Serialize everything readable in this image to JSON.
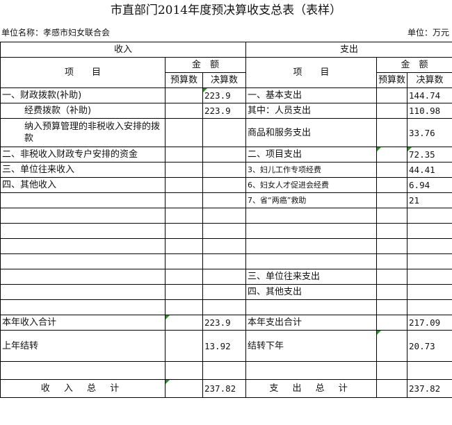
{
  "title": "市直部门2014年度预决算收支总表（表样）",
  "unit_name": "单位名称：孝感市妇女联合会",
  "unit": "单位：万元",
  "headers": {
    "income": "收入",
    "expense": "支出",
    "item": "项　　目",
    "amount": "金　额",
    "budget": "预算数",
    "final": "决算数"
  },
  "income_rows": [
    {
      "label": "一、财政拨款(补助)",
      "budget": "",
      "final": "223.9"
    },
    {
      "label": "经费拨款（补助)",
      "budget": "",
      "final": "223.9"
    },
    {
      "label": "纳入预算管理的非税收入安排的拨款",
      "budget": "",
      "final": ""
    },
    {
      "label": "二、非税收入财政专户安排的资金",
      "budget": "",
      "final": ""
    },
    {
      "label": "三、单位往来收入",
      "budget": "",
      "final": ""
    },
    {
      "label": "四、其他收入",
      "budget": "",
      "final": ""
    }
  ],
  "expense_rows": [
    {
      "label": "一、基本支出",
      "budget": "",
      "final": "144.74"
    },
    {
      "label": "其中：人员支出",
      "budget": "",
      "final": "110.98"
    },
    {
      "label": "商品和服务支出",
      "budget": "",
      "final": "33.76"
    },
    {
      "label": "二、项目支出",
      "budget": "",
      "final": "72.35"
    },
    {
      "label": "3、妇儿工作专项经费",
      "budget": "",
      "final": "44.41"
    },
    {
      "label": "6、妇女人才促进会经费",
      "budget": "",
      "final": "6.94"
    },
    {
      "label": "7、省“两癌”救助",
      "budget": "",
      "final": "21"
    },
    {
      "label": "三、单位往来支出",
      "budget": "",
      "final": ""
    },
    {
      "label": "四、其他支出",
      "budget": "",
      "final": ""
    }
  ],
  "totals": {
    "income_year_label": "本年收入合计",
    "income_year_final": "223.9",
    "expense_year_label": "本年支出合计",
    "expense_year_final": "217.09",
    "carry_in_label": "上年结转",
    "carry_in_final": "13.92",
    "carry_out_label": "结转下年",
    "carry_out_final": "20.73",
    "income_total_label": "收 入 总 计",
    "income_total_final": "237.82",
    "expense_total_label": "支 出 总 计",
    "expense_total_final": "237.82"
  }
}
